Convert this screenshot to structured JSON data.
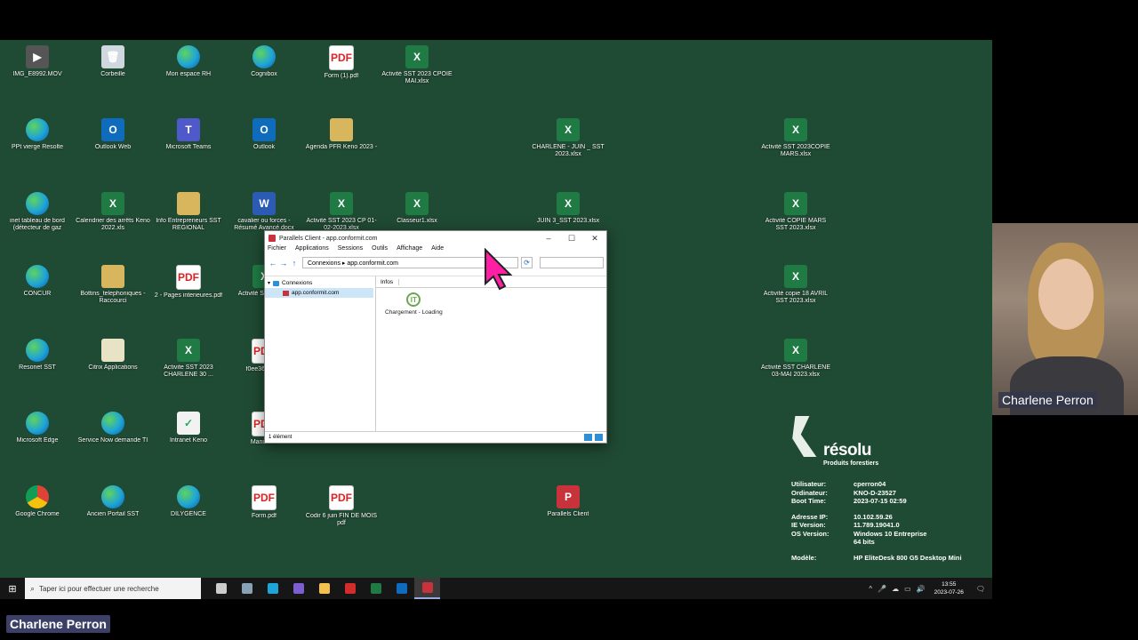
{
  "desktop_icons": [
    {
      "label": "IMG_E8992.MOV",
      "kind": "video",
      "g": "▶"
    },
    {
      "label": "Corbeille",
      "kind": "bin",
      "g": "🗑"
    },
    {
      "label": "Mon espace RH",
      "kind": "edge",
      "g": ""
    },
    {
      "label": "Cognibox",
      "kind": "edge",
      "g": ""
    },
    {
      "label": "Form (1).pdf",
      "kind": "pdf",
      "g": "PDF"
    },
    {
      "label": "Activité SST 2023 CPOIE MAI.xlsx",
      "kind": "excel",
      "g": "X"
    },
    {
      "label": "PPt vierge Resolte",
      "kind": "edge",
      "g": ""
    },
    {
      "label": "Outlook Web",
      "kind": "outlook",
      "g": "O"
    },
    {
      "label": "Microsoft Teams",
      "kind": "teams",
      "g": "T"
    },
    {
      "label": "Outlook",
      "kind": "outlook",
      "g": "O"
    },
    {
      "label": "Agenda PFR Keno 2023 -",
      "kind": "folder",
      "g": ""
    },
    {
      "label": "CHARLENE - JUIN _ SST 2023.xlsx",
      "kind": "excel",
      "g": "X"
    },
    {
      "label": "Activité SST 2023COPIE MARS.xlsx",
      "kind": "excel",
      "g": "X"
    },
    {
      "label": "inet tableau de bord (détecteur de gaz",
      "kind": "edge",
      "g": ""
    },
    {
      "label": "Calendrier des arrêts Keno 2022.xls",
      "kind": "excel",
      "g": "X"
    },
    {
      "label": "Info Entrepreneurs SST REGIONAL",
      "kind": "folder",
      "g": ""
    },
    {
      "label": "cavalier ou forces - Résumé Avancé.docx",
      "kind": "word",
      "g": "W"
    },
    {
      "label": "Activité SST 2023 CP 01-02-2023.xlsx",
      "kind": "excel",
      "g": "X"
    },
    {
      "label": "Classeur1.xlsx",
      "kind": "excel",
      "g": "X"
    },
    {
      "label": "JUIN 3_SST 2023.xlsx",
      "kind": "excel",
      "g": "X"
    },
    {
      "label": "Activité COPIE MARS SST 2023.xlsx",
      "kind": "excel",
      "g": "X"
    },
    {
      "label": "CONCUR",
      "kind": "edge",
      "g": ""
    },
    {
      "label": "Bottins_telephoniques - Raccourci",
      "kind": "folder",
      "g": ""
    },
    {
      "label": "2 - Pages interieures.pdf",
      "kind": "pdf",
      "g": "PDF"
    },
    {
      "label": "Activité SST FÉVR",
      "kind": "excel",
      "g": "X"
    },
    {
      "label": "Activité copie 18 AVRIL SST 2023.xlsx",
      "kind": "excel",
      "g": "X"
    },
    {
      "label": "Resonet SST",
      "kind": "edge",
      "g": ""
    },
    {
      "label": "Citrix Applications",
      "kind": "citrix",
      "g": ""
    },
    {
      "label": "Activite SST 2023 CHARLENE 30 ...",
      "kind": "excel",
      "g": "X"
    },
    {
      "label": "f0ee36b2a97",
      "kind": "pdf",
      "g": "PDF"
    },
    {
      "label": "Activité SST CHARLENE 03-MAI 2023.xlsx",
      "kind": "excel",
      "g": "X"
    },
    {
      "label": "Microsoft Edge",
      "kind": "edge",
      "g": ""
    },
    {
      "label": "Service Now demande TI",
      "kind": "edge",
      "g": ""
    },
    {
      "label": "Intranet Keno",
      "kind": "file",
      "g": "✓"
    },
    {
      "label": "Manifeste",
      "kind": "pdf",
      "g": "PDF"
    },
    {
      "label": "Google Chrome",
      "kind": "chrome",
      "g": ""
    },
    {
      "label": "Ancien Portail SST",
      "kind": "edge",
      "g": ""
    },
    {
      "label": "DILYGENCE",
      "kind": "edge",
      "g": ""
    },
    {
      "label": "Form.pdf",
      "kind": "pdf",
      "g": "PDF"
    },
    {
      "label": "Codir 6 juin FIN DE MOIS pdf",
      "kind": "pdf",
      "g": "PDF"
    },
    {
      "label": "Parallels Client",
      "kind": "par",
      "g": "P"
    }
  ],
  "window": {
    "title": "Parallels Client - app.conformit.com",
    "minimize": "–",
    "maximize": "☐",
    "close": "✕",
    "menu": [
      "Fichier",
      "Applications",
      "Sessions",
      "Outils",
      "Affichage",
      "Aide"
    ],
    "back": "←",
    "forward": "→",
    "up": "↑",
    "path": "Connexions ▸ app.conformit.com",
    "refresh": "⟳",
    "tree_root": "Connexions",
    "tree_child": "app.conformit.com",
    "tab": "Infos",
    "loading_glyph": "IT",
    "loading_text": "Chargement - Loading",
    "status": "1 élément"
  },
  "brand": {
    "name": "résolu",
    "sub": "Produits forestiers"
  },
  "sysinfo": [
    {
      "k": "Utilisateur:",
      "v": "cperron04"
    },
    {
      "k": "Ordinateur:",
      "v": "KNO-D-23527"
    },
    {
      "k": "Boot Time:",
      "v": "2023-07-15 02:59"
    },
    {
      "k": "Adresse IP:",
      "v": "10.102.59.26"
    },
    {
      "k": "IE Version:",
      "v": "11.789.19041.0"
    },
    {
      "k": "OS Version:",
      "v": "Windows 10 Entreprise"
    },
    {
      "k": "",
      "v": "64 bits"
    },
    {
      "k": "Modèle:",
      "v": "HP EliteDesk 800 G5 Desktop Mini"
    }
  ],
  "taskbar": {
    "start": "⊞",
    "search_icon": "⌕",
    "search_placeholder": "Taper ici pour effectuer une recherche",
    "apps": [
      {
        "name": "task-view",
        "color": "#cccccc"
      },
      {
        "name": "app-1",
        "color": "#8aa0b4"
      },
      {
        "name": "edge",
        "color": "#1ea4d8"
      },
      {
        "name": "teams",
        "color": "#7b5ecf"
      },
      {
        "name": "file-explorer",
        "color": "#f2c14e"
      },
      {
        "name": "acrobat",
        "color": "#d22c2c"
      },
      {
        "name": "excel",
        "color": "#1f7a43"
      },
      {
        "name": "outlook",
        "color": "#0f6cbd"
      },
      {
        "name": "parallels",
        "color": "#c8323a"
      }
    ],
    "tray_icons": [
      "^",
      "🎤",
      "☁",
      "▭",
      "🔊"
    ],
    "time": "13:55",
    "date": "2023-07-26",
    "notif": "🗨"
  },
  "video": {
    "participant": "Charlene Perron"
  },
  "self_label": "Charlene Perron"
}
